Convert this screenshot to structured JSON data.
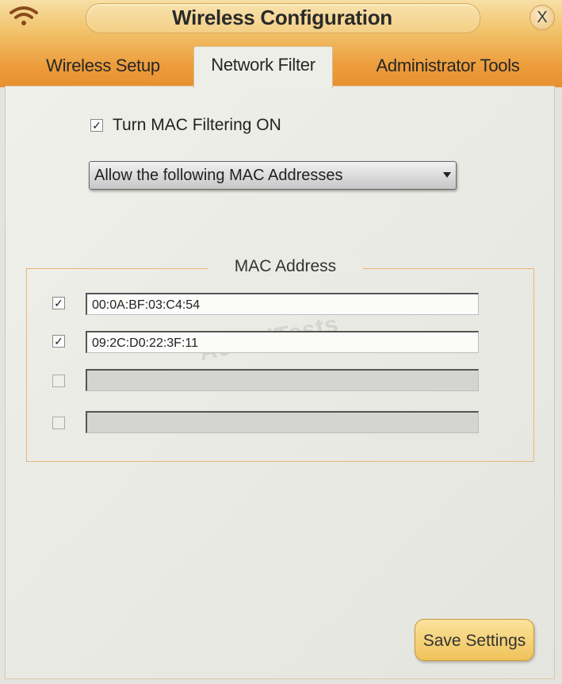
{
  "window": {
    "title": "Wireless Configuration",
    "close_label": "X"
  },
  "tabs": [
    {
      "label": "Wireless Setup",
      "active": false
    },
    {
      "label": "Network Filter",
      "active": true
    },
    {
      "label": "Administrator Tools",
      "active": false
    }
  ],
  "mac_filtering": {
    "checkbox_checked": true,
    "label": "Turn MAC Filtering ON",
    "mode_selected": "Allow the following MAC Addresses"
  },
  "mac_table": {
    "header": "MAC Address",
    "rows": [
      {
        "checked": true,
        "value": "00:0A:BF:03:C4:54"
      },
      {
        "checked": true,
        "value": "09:2C:D0:22:3F:11"
      },
      {
        "checked": false,
        "value": ""
      },
      {
        "checked": false,
        "value": ""
      }
    ]
  },
  "watermark": "ActualTests",
  "actions": {
    "save_label": "Save Settings"
  },
  "colors": {
    "header_orange": "#ec9d3c",
    "accent_gold": "#f0c25a",
    "fieldset_border": "#e7b678"
  },
  "icons": {
    "wifi": "wifi-icon",
    "close": "close-icon",
    "check": "checkmark-icon",
    "dropdown": "dropdown-arrow-icon"
  }
}
